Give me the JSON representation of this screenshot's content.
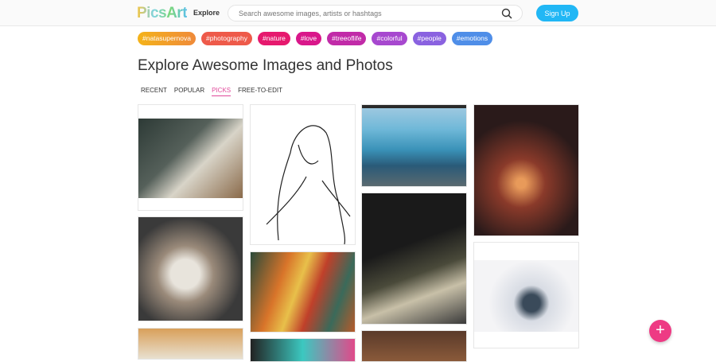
{
  "header": {
    "logo": "PicsArt",
    "explore": "Explore",
    "search_placeholder": "Search awesome images, artists or hashtags",
    "signup": "Sign Up"
  },
  "tags": [
    {
      "label": "#natasupernova",
      "color": "#f2a81d"
    },
    {
      "label": "#photography",
      "color": "#ee5a4a"
    },
    {
      "label": "#nature",
      "color": "#e6196e"
    },
    {
      "label": "#love",
      "color": "#d9178a"
    },
    {
      "label": "#treeoflife",
      "color": "#c12ba8"
    },
    {
      "label": "#colorful",
      "color": "#a748cf"
    },
    {
      "label": "#people",
      "color": "#8a62e0"
    },
    {
      "label": "#emotions",
      "color": "#4f8ee8"
    }
  ],
  "title": "Explore Awesome Images and Photos",
  "tabs": [
    "RECENT",
    "POPULAR",
    "PICKS",
    "FREE-TO-EDIT"
  ],
  "active_tab": "PICKS",
  "fab": "+"
}
